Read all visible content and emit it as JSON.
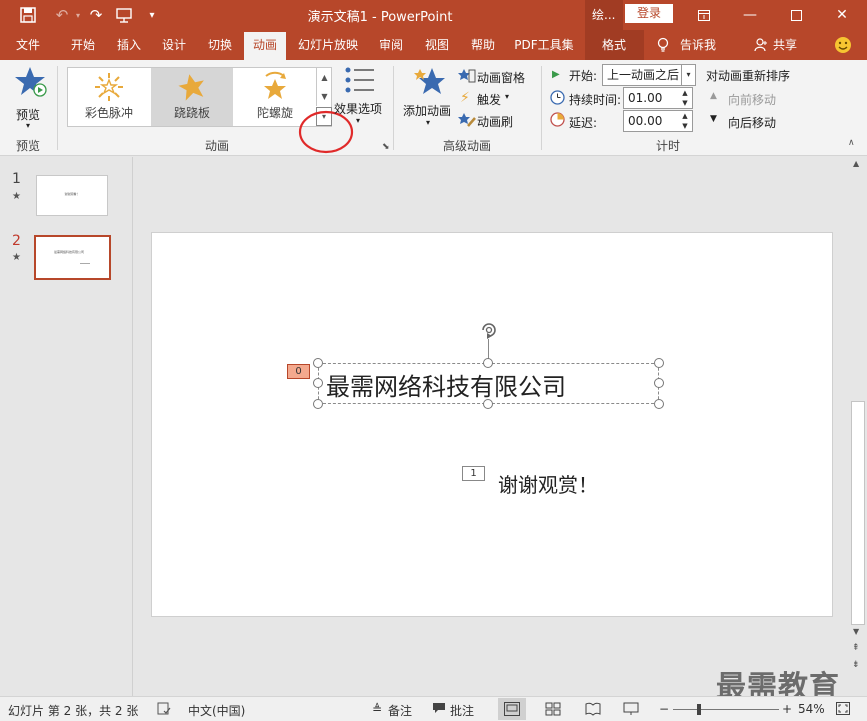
{
  "app": {
    "doc_title": "演示文稿1",
    "separator": "-",
    "app_name": "PowerPoint",
    "draw_tab": "绘...",
    "login": "登录"
  },
  "colors": {
    "accent": "#b7472a",
    "accent_dark": "#a13c23",
    "star_blue": "#3a6ab0",
    "gold": "#e8a93b",
    "anim_marker": "#f4a98e"
  },
  "tabs": [
    "文件",
    "开始",
    "插入",
    "设计",
    "切换",
    "动画",
    "幻灯片放映",
    "审阅",
    "视图",
    "帮助",
    "PDF工具集",
    "格式"
  ],
  "tabs_active": "动画",
  "tell_me": "告诉我",
  "share": "共享",
  "ribbon": {
    "preview": {
      "label": "预览",
      "group": "预览"
    },
    "animation_group": "动画",
    "gallery": [
      "彩色脉冲",
      "跷跷板",
      "陀螺旋"
    ],
    "effect_options": "效果选项",
    "advanced": {
      "group": "高级动画",
      "add_animation": "添加动画",
      "pane": "动画窗格",
      "trigger": "触发",
      "painter": "动画刷"
    },
    "timing": {
      "group": "计时",
      "start_label": "开始:",
      "start_value": "上一动画之后",
      "duration_label": "持续时间:",
      "duration_value": "01.00",
      "delay_label": "延迟:",
      "delay_value": "00.00",
      "reorder": "对动画重新排序",
      "move_earlier": "向前移动",
      "move_later": "向后移动"
    }
  },
  "slides_panel": [
    {
      "num": "1",
      "thumb_text": "谢谢观看！"
    },
    {
      "num": "2",
      "thumb_text": "最需网络科技有限公司"
    }
  ],
  "slide": {
    "title": "最需网络科技有限公司",
    "subtitle": "谢谢观赏！",
    "marker_title": "0",
    "marker_subtitle": "1"
  },
  "status": {
    "slide_info": "幻灯片 第 2 张，共 2 张",
    "language": "中文(中国)",
    "notes": "备注",
    "comments": "批注",
    "zoom": "54%"
  },
  "watermark": "最需教育"
}
